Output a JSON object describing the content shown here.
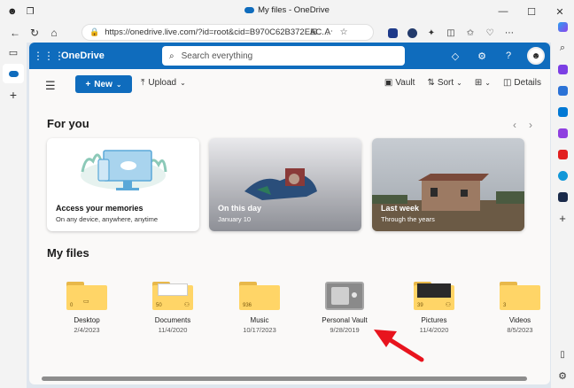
{
  "browser": {
    "window_title": "My files - OneDrive",
    "url": "https://onedrive.live.com/?id=root&cid=B970C62B372EAC..."
  },
  "onedrive": {
    "app_name": "OneDrive",
    "search_placeholder": "Search everything",
    "new_label": "New",
    "upload_label": "Upload",
    "vault_label": "Vault",
    "sort_label": "Sort",
    "details_label": "Details"
  },
  "for_you": {
    "title": "For you",
    "cards": [
      {
        "title": "Access your memories",
        "subtitle": "On any device, anywhere, anytime"
      },
      {
        "title": "On this day",
        "subtitle": "January 10"
      },
      {
        "title": "Last week",
        "subtitle": "Through the years"
      }
    ]
  },
  "my_files": {
    "title": "My files",
    "items": [
      {
        "name": "Desktop",
        "date": "2/4/2023",
        "count": "0"
      },
      {
        "name": "Documents",
        "date": "11/4/2020",
        "count": "50"
      },
      {
        "name": "Music",
        "date": "10/17/2023",
        "count": "936"
      },
      {
        "name": "Personal Vault",
        "date": "9/28/2019",
        "count": ""
      },
      {
        "name": "Pictures",
        "date": "11/4/2020",
        "count": "39"
      },
      {
        "name": "Videos",
        "date": "8/5/2023",
        "count": "3"
      }
    ]
  },
  "colors": {
    "brand": "#0f6cbd",
    "folder": "#ffd567",
    "annotation_arrow": "#e8141e"
  }
}
